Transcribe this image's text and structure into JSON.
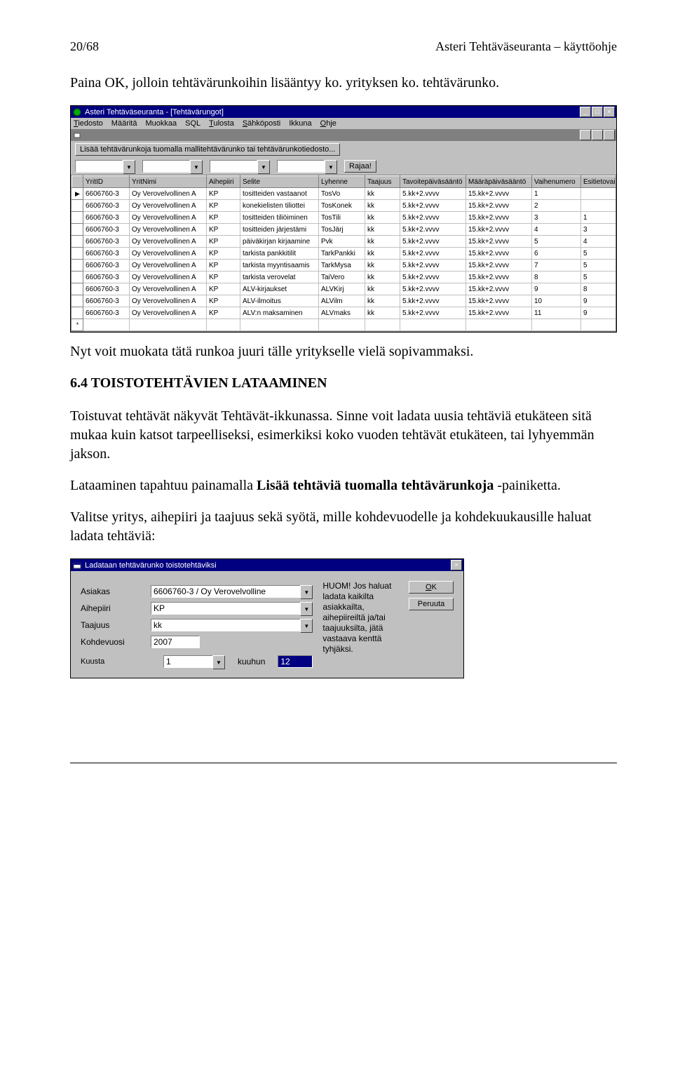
{
  "header": {
    "left": "20/68",
    "right": "Asteri Tehtäväseuranta – käyttöohje"
  },
  "body": {
    "p1": "Paina OK, jolloin tehtävärunkoihin lisääntyy ko. yrityksen ko. tehtävärunko.",
    "p2": "Nyt voit muokata tätä runkoa juuri tälle yritykselle vielä sopivammaksi.",
    "sec": "6.4 TOISTOTEHTÄVIEN LATAAMINEN",
    "p3": "Toistuvat tehtävät näkyvät Tehtävät-ikkunassa. Sinne voit ladata uusia tehtäviä etukäteen sitä mukaa kuin katsot tarpeelliseksi, esimerkiksi koko vuoden tehtävät etukäteen, tai lyhyemmän jakson.",
    "p4a": "Lataaminen tapahtuu painamalla ",
    "p4b": "Lisää tehtäviä tuomalla tehtävärunkoja",
    "p4c": " -painiketta.",
    "p5": "Valitse yritys, aihepiiri ja taajuus sekä syötä, mille kohdevuodelle ja kohdekuukausille haluat ladata tehtäviä:"
  },
  "win1": {
    "title": "Asteri Tehtäväseuranta - [Tehtävärungot]",
    "menu": [
      "Tiedosto",
      "Määritä",
      "Muokkaa",
      "SQL",
      "Tulosta",
      "Sähköposti",
      "Ikkuna",
      "Ohje"
    ],
    "toolbar_btn": "Lisää tehtävärunkoja tuomalla mallitehtävärunko tai tehtävärunkotiedosto...",
    "filter_btn": "Rajaa!",
    "columns": [
      "YritID",
      "YritNimi",
      "Aihepiiri",
      "Selite",
      "Lyhenne",
      "Taajuus",
      "Tavoitepäiväsääntö",
      "Määräpäiväsääntö",
      "Vaihenumero",
      "Esitietovaih"
    ],
    "rows": [
      [
        "6606760-3",
        "Oy Verovelvollinen A",
        "KP",
        "tositteiden vastaanot",
        "TosVo",
        "kk",
        "5.kk+2.vvvv",
        "15.kk+2.vvvv",
        "1",
        ""
      ],
      [
        "6606760-3",
        "Oy Verovelvollinen A",
        "KP",
        "konekielisten tiliottei",
        "TosKonek",
        "kk",
        "5.kk+2.vvvv",
        "15.kk+2.vvvv",
        "2",
        ""
      ],
      [
        "6606760-3",
        "Oy Verovelvollinen A",
        "KP",
        "tositteiden tiliöiminen",
        "TosTili",
        "kk",
        "5.kk+2.vvvv",
        "15.kk+2.vvvv",
        "3",
        "1"
      ],
      [
        "6606760-3",
        "Oy Verovelvollinen A",
        "KP",
        "tositteiden järjestämi",
        "TosJärj",
        "kk",
        "5.kk+2.vvvv",
        "15.kk+2.vvvv",
        "4",
        "3"
      ],
      [
        "6606760-3",
        "Oy Verovelvollinen A",
        "KP",
        "päiväkirjan kirjaamine",
        "Pvk",
        "kk",
        "5.kk+2.vvvv",
        "15.kk+2.vvvv",
        "5",
        "4"
      ],
      [
        "6606760-3",
        "Oy Verovelvollinen A",
        "KP",
        "tarkista pankkitilit",
        "TarkPankki",
        "kk",
        "5.kk+2.vvvv",
        "15.kk+2.vvvv",
        "6",
        "5"
      ],
      [
        "6606760-3",
        "Oy Verovelvollinen A",
        "KP",
        "tarkista myyntisaamis",
        "TarkMysa",
        "kk",
        "5.kk+2.vvvv",
        "15.kk+2.vvvv",
        "7",
        "5"
      ],
      [
        "6606760-3",
        "Oy Verovelvollinen A",
        "KP",
        "tarkista verovelat",
        "TaiVero",
        "kk",
        "5.kk+2.vvvv",
        "15.kk+2.vvvv",
        "8",
        "5"
      ],
      [
        "6606760-3",
        "Oy Verovelvollinen A",
        "KP",
        "ALV-kirjaukset",
        "ALVKirj",
        "kk",
        "5.kk+2.vvvv",
        "15.kk+2.vvvv",
        "9",
        "8"
      ],
      [
        "6606760-3",
        "Oy Verovelvollinen A",
        "KP",
        "ALV-ilmoitus",
        "ALVilm",
        "kk",
        "5.kk+2.vvvv",
        "15.kk+2.vvvv",
        "10",
        "9"
      ],
      [
        "6606760-3",
        "Oy Verovelvollinen A",
        "KP",
        "ALV:n maksaminen",
        "ALVmaks",
        "kk",
        "5.kk+2.vvvv",
        "15.kk+2.vvvv",
        "11",
        "9"
      ]
    ]
  },
  "dlg": {
    "title": "Ladataan tehtävärunko toistotehtäviksi",
    "labels": {
      "asiakas": "Asiakas",
      "aihepiiri": "Aihepiiri",
      "taajuus": "Taajuus",
      "kohdevuosi": "Kohdevuosi",
      "kuusta": "Kuusta",
      "kuuhun": "kuuhun"
    },
    "values": {
      "asiakas": "6606760-3 / Oy Verovelvolline",
      "aihepiiri": "KP",
      "taajuus": "kk",
      "kohdevuosi": "2007",
      "kuusta": "1",
      "kuuhun": "12"
    },
    "hint": "HUOM! Jos haluat ladata kaikilta asiakkailta, aihepiireiltä ja/tai taajuuksilta, jätä vastaava kenttä tyhjäksi.",
    "ok": "OK",
    "cancel": "Peruuta"
  }
}
